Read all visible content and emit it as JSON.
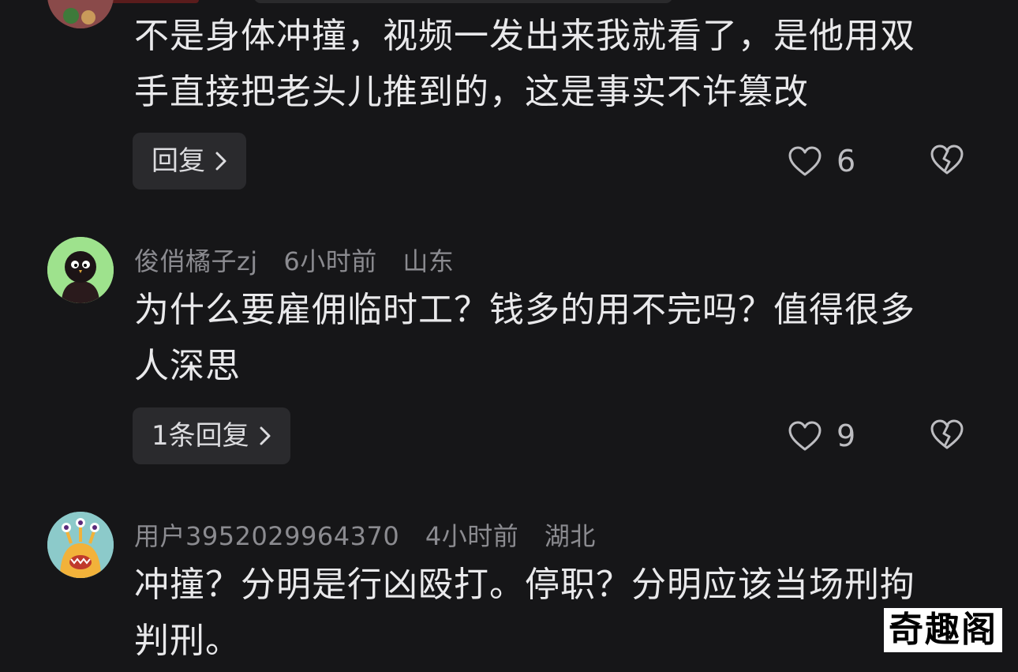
{
  "comments": [
    {
      "text_line1": "不是身体冲撞，视频一发出来我就看了，是他用双",
      "text_line2": "手直接把老头儿推到的，这是事实不许篡改",
      "reply_label": "回复",
      "likes": "6"
    },
    {
      "username": "俊俏橘子zj",
      "time": "6小时前",
      "location": "山东",
      "text_line1": "为什么要雇佣临时工？钱多的用不完吗？值得很多",
      "text_line2": "人深思",
      "reply_label": "1条回复",
      "likes": "9"
    },
    {
      "username": "用户3952029964370",
      "time": "4小时前",
      "location": "湖北",
      "text_line1": "冲撞？分明是行凶殴打。停职？分明应该当场刑拘",
      "text_line2": "判刑。"
    }
  ],
  "watermark": "奇趣阁",
  "icons": {
    "like": "heart-outline-icon",
    "dislike": "broken-heart-icon",
    "reply_arrow": "chevron-right-icon"
  }
}
